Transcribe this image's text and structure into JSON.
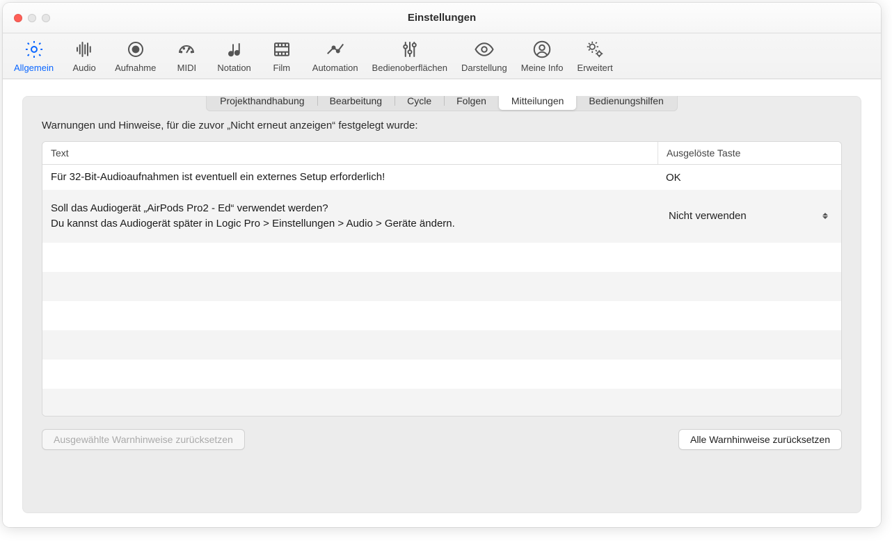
{
  "window": {
    "title": "Einstellungen"
  },
  "toolbar": [
    {
      "id": "general",
      "label": "Allgemein",
      "active": true
    },
    {
      "id": "audio",
      "label": "Audio",
      "active": false
    },
    {
      "id": "recording",
      "label": "Aufnahme",
      "active": false
    },
    {
      "id": "midi",
      "label": "MIDI",
      "active": false
    },
    {
      "id": "notation",
      "label": "Notation",
      "active": false
    },
    {
      "id": "film",
      "label": "Film",
      "active": false
    },
    {
      "id": "automation",
      "label": "Automation",
      "active": false
    },
    {
      "id": "surfaces",
      "label": "Bedienoberflächen",
      "active": false
    },
    {
      "id": "display",
      "label": "Darstellung",
      "active": false
    },
    {
      "id": "myinfo",
      "label": "Meine Info",
      "active": false
    },
    {
      "id": "advanced",
      "label": "Erweitert",
      "active": false
    }
  ],
  "tabs": [
    {
      "id": "projecthandling",
      "label": "Projekthandhabung",
      "active": false
    },
    {
      "id": "editing",
      "label": "Bearbeitung",
      "active": false
    },
    {
      "id": "cycle",
      "label": "Cycle",
      "active": false
    },
    {
      "id": "follow",
      "label": "Folgen",
      "active": false
    },
    {
      "id": "notifications",
      "label": "Mitteilungen",
      "active": true
    },
    {
      "id": "accessibility",
      "label": "Bedienungshilfen",
      "active": false
    }
  ],
  "description": "Warnungen und Hinweise, für die zuvor „Nicht erneut anzeigen“ festgelegt wurde:",
  "table": {
    "columns": {
      "text": "Text",
      "action": "Ausgelöste Taste"
    },
    "rows": [
      {
        "text": "Für 32-Bit-Audioaufnahmen ist eventuell ein externes Setup erforderlich!",
        "action_type": "static",
        "action_label": "OK"
      },
      {
        "text": "Soll das Audiogerät „AirPods Pro2 - Ed“ verwendet werden?\nDu kannst das Audiogerät später in Logic Pro > Einstellungen > Audio > Geräte ändern.",
        "action_type": "popup",
        "action_label": "Nicht verwenden"
      }
    ]
  },
  "buttons": {
    "reset_selected": "Ausgewählte Warnhinweise zurücksetzen",
    "reset_all": "Alle Warnhinweise zurücksetzen"
  }
}
